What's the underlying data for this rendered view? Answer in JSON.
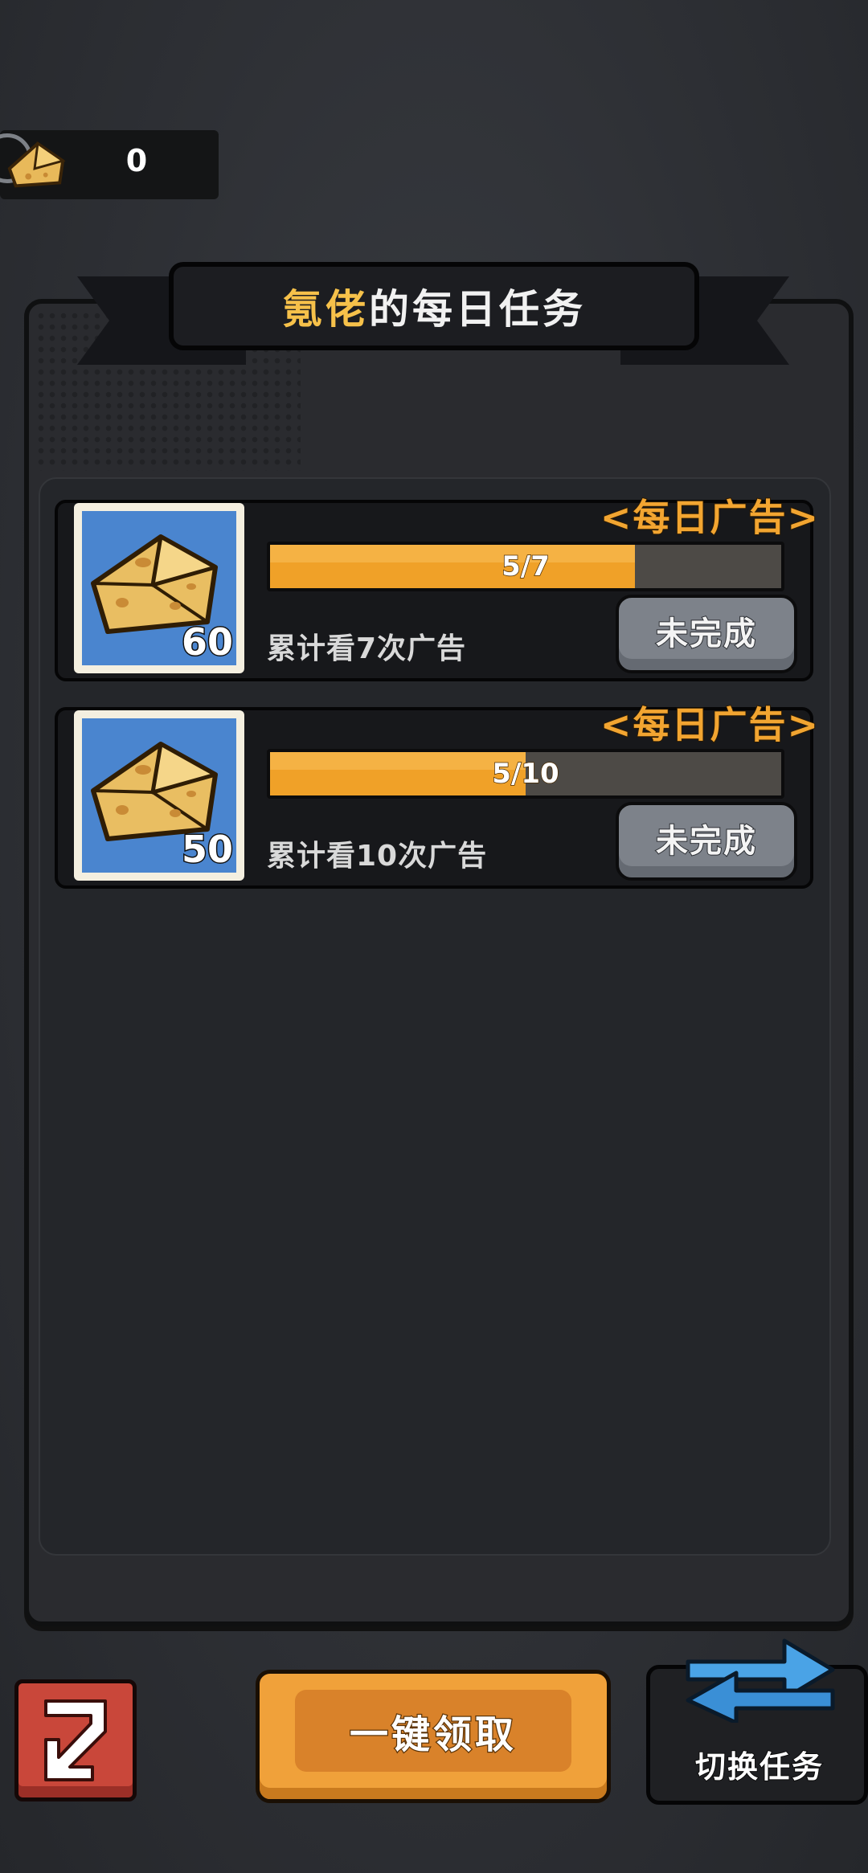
{
  "currency": {
    "value": "0",
    "icon": "cheese-icon"
  },
  "title": {
    "name": "氪佬",
    "suffix": "的每日任务"
  },
  "tasks": [
    {
      "tag": "<每日广告>",
      "reward": "60",
      "progress_text": "5/7",
      "progress": 0.714,
      "description": "累计看7次广告",
      "status": "未完成"
    },
    {
      "tag": "<每日广告>",
      "reward": "50",
      "progress_text": "5/10",
      "progress": 0.5,
      "description": "累计看10次广告",
      "status": "未完成"
    }
  ],
  "bottom": {
    "collect_all": "一键领取",
    "switch_tasks": "切换任务"
  },
  "colors": {
    "accent_orange": "#f0a128",
    "title_name": "#f6c14a",
    "icon_bg": "#4a85cf",
    "back_red": "#c9473a"
  }
}
